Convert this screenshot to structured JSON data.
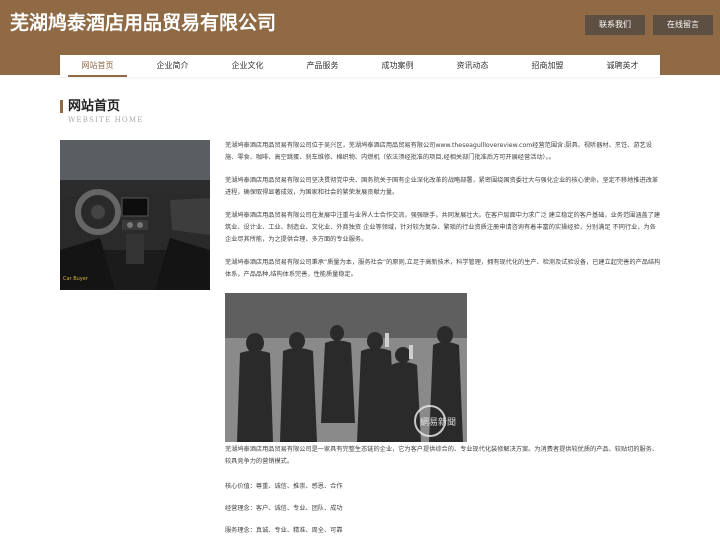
{
  "header": {
    "site_title": "芜湖鸠泰酒店用品贸易有限公司",
    "contact_button": "联系我们",
    "message_button": "在线留言"
  },
  "nav": {
    "items": [
      {
        "label": "网站首页"
      },
      {
        "label": "企业简介"
      },
      {
        "label": "企业文化"
      },
      {
        "label": "产品服务"
      },
      {
        "label": "成功案例"
      },
      {
        "label": "资讯动态"
      },
      {
        "label": "招商加盟"
      },
      {
        "label": "诚聘英才"
      }
    ],
    "active": "网站首页"
  },
  "section": {
    "title": "网站首页",
    "subtitle": "WEBSITE HOME"
  },
  "content": {
    "p1": "芜湖鸠泰酒店用品贸易有限公司位于吴兴区，芜湖鸠泰酒店用品贸易有限公司www.theseagulllovereview.com经营范围含:厨具、视听器材、烹饪、游艺设施、零食、咖啡、高空跳蛋、刹车维修、棉织物、内燃机（依法须经批准的项目,经相关部门批准后方可开展经营活动）。。",
    "p2": "芜湖鸠泰酒店用品贸易有限公司坚决贯彻党中央、国务院关于国有企业深化改革的战略部署，紧密围绕国资委壮大与强化企业的核心使命，坚定不移地推进改革进程，确保取得显著成效，为国家和社会的繁荣发展贡献力量。",
    "p3": "芜湖鸠泰酒店用品贸易有限公司在发展中注重与业界人士合作交流，强强联手，共同发展壮大。在客户层面中力求广泛 建立稳定的客户基础，业务范围涵盖了建筑业、设计业、工业、制造业、文化业、外商独资 企业等领域，针对较为复杂、繁琐的行业资质注册申请咨询有着丰富的实操经验，分别满足 不同行业，为各企业尽其所能，为之提供合理、多方面的专业服务。",
    "p4": "芜湖鸠泰酒店用品贸易有限公司秉承“质量为本，服务社会”的原则,立足于高新技术，科学管理，拥有现代化的生产、检测及试验设备，已建立起完善的产品结构体系，产品品种,结构体系完善，性能质量稳定。",
    "p5": "芜湖鸠泰酒店用品贸易有限公司是一家具有完整生态链的企业，它为客户提供综合的、专业现代化装修解决方案。为消费者提供较优质的产品、较贴切的服务、较具竞争力的营销模式。",
    "values": "核心价值：尊重、诚信、推崇、感恩、合作",
    "philosophy": "经营理念：客户、诚信、专业、团队、成功",
    "service": "服务理念：真诚、专业、精准、周全、可靠"
  },
  "images": {
    "car_caption": "Car Buyer",
    "crowd_watermark": "網易新聞"
  },
  "colors": {
    "brand": "#8f6a45",
    "button_bg": "#5e4f43"
  }
}
